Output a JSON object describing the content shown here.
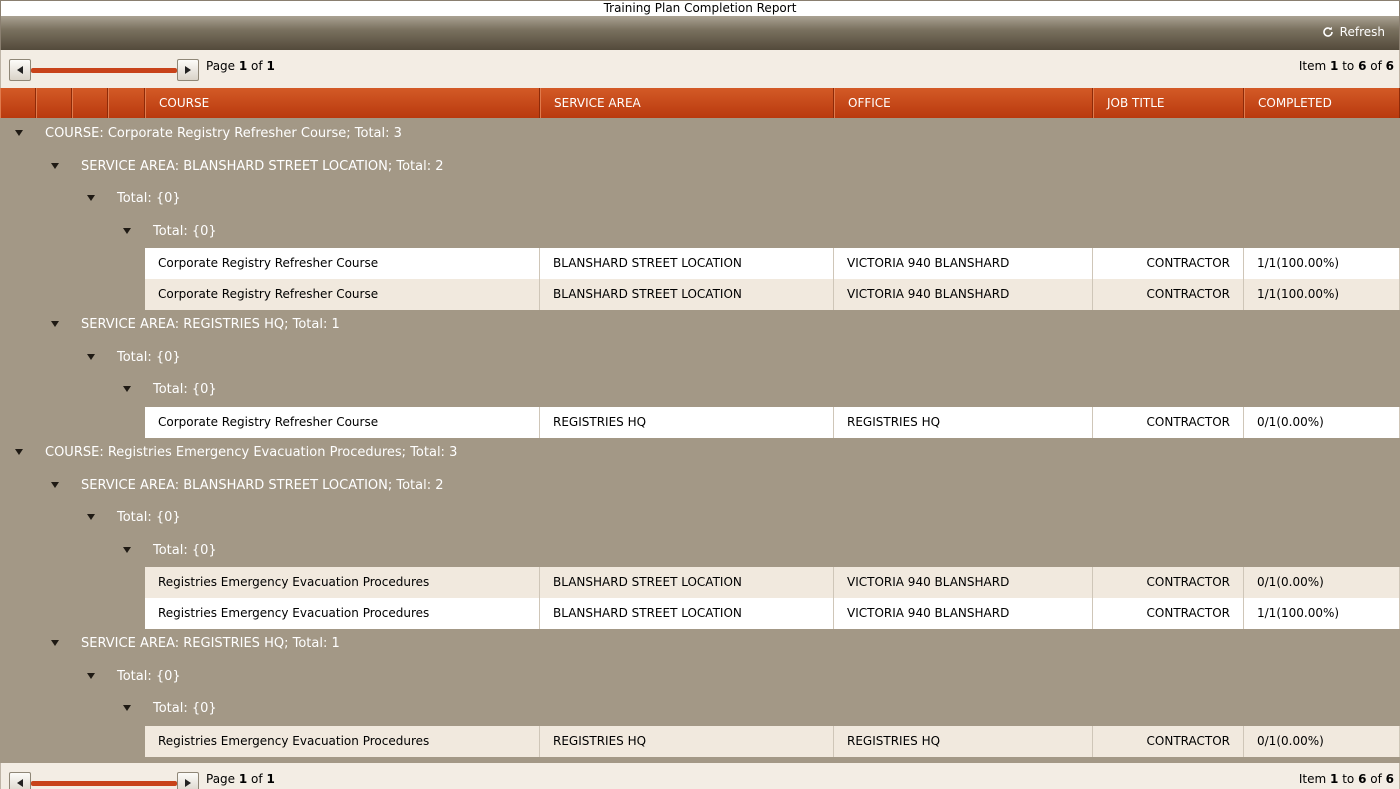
{
  "window": {
    "title": "Training Plan Completion Report"
  },
  "toolbar": {
    "refresh_label": "Refresh"
  },
  "pager": {
    "page_prefix": "Page ",
    "page_current": "1",
    "page_of": " of ",
    "page_total": "1",
    "item_prefix": "Item ",
    "item_from": "1",
    "item_to_word": " to ",
    "item_to": "6",
    "item_of_word": " of ",
    "item_total": "6"
  },
  "columns": [
    "COURSE",
    "SERVICE AREA",
    "OFFICE",
    "JOB TITLE",
    "COMPLETED"
  ],
  "groups": [
    {
      "level": 0,
      "label": "COURSE: Corporate Registry Refresher Course; Total: 3"
    },
    {
      "level": 1,
      "label": "SERVICE AREA: BLANSHARD STREET LOCATION; Total: 2"
    },
    {
      "level": 2,
      "label": "Total: {0}"
    },
    {
      "level": 3,
      "label": "Total: {0}"
    },
    {
      "level": 1,
      "label": "SERVICE AREA: REGISTRIES HQ; Total: 1"
    },
    {
      "level": 2,
      "label": "Total: {0}"
    },
    {
      "level": 3,
      "label": "Total: {0}"
    },
    {
      "level": 0,
      "label": "COURSE: Registries Emergency Evacuation Procedures; Total: 3"
    },
    {
      "level": 1,
      "label": "SERVICE AREA: BLANSHARD STREET LOCATION; Total: 2"
    },
    {
      "level": 2,
      "label": "Total: {0}"
    },
    {
      "level": 3,
      "label": "Total: {0}"
    },
    {
      "level": 1,
      "label": "SERVICE AREA: REGISTRIES HQ; Total: 1"
    },
    {
      "level": 2,
      "label": "Total: {0}"
    },
    {
      "level": 3,
      "label": "Total: {0}"
    }
  ],
  "rows": [
    [
      "Corporate Registry Refresher Course",
      "BLANSHARD STREET LOCATION",
      "VICTORIA 940 BLANSHARD",
      "CONTRACTOR",
      "1/1(100.00%)"
    ],
    [
      "Corporate Registry Refresher Course",
      "BLANSHARD STREET LOCATION",
      "VICTORIA 940 BLANSHARD",
      "CONTRACTOR",
      "1/1(100.00%)"
    ],
    [
      "Corporate Registry Refresher Course",
      "REGISTRIES HQ",
      "REGISTRIES HQ",
      "CONTRACTOR",
      "0/1(0.00%)"
    ],
    [
      "Registries Emergency Evacuation Procedures",
      "BLANSHARD STREET LOCATION",
      "VICTORIA 940 BLANSHARD",
      "CONTRACTOR",
      "0/1(0.00%)"
    ],
    [
      "Registries Emergency Evacuation Procedures",
      "BLANSHARD STREET LOCATION",
      "VICTORIA 940 BLANSHARD",
      "CONTRACTOR",
      "1/1(100.00%)"
    ],
    [
      "Registries Emergency Evacuation Procedures",
      "REGISTRIES HQ",
      "REGISTRIES HQ",
      "CONTRACTOR",
      "0/1(0.00%)"
    ]
  ]
}
